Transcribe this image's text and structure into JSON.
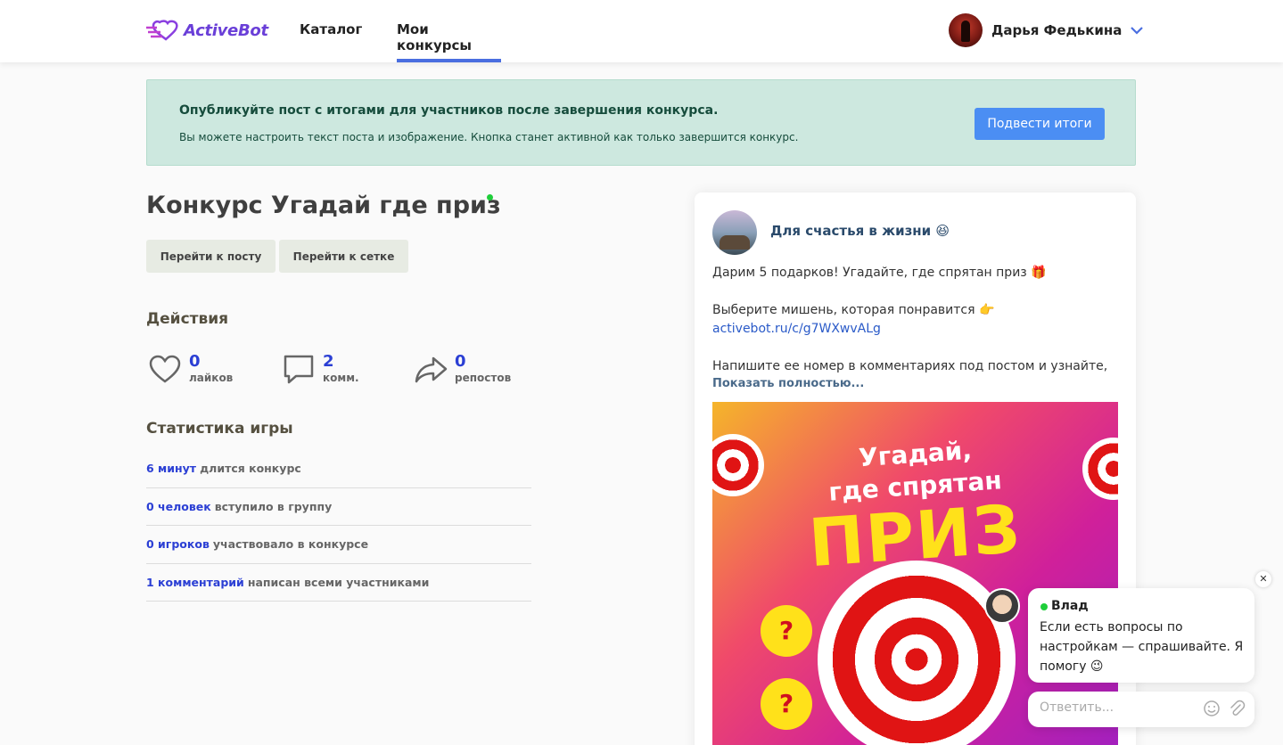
{
  "header": {
    "logo": "ActiveBot",
    "nav": {
      "catalog": "Каталог",
      "my_contests": "Мои конкурсы"
    },
    "user_name": "Дарья Федькина"
  },
  "banner": {
    "title": "Опубликуйте пост с итогами для участников после завершения конкурса.",
    "text": "Вы можете настроить текст поста и изображение. Кнопка станет активной как только завершится конкурс.",
    "button": "Подвести итоги"
  },
  "contest": {
    "title": "Конкурс Угадай где приз",
    "btn_post": "Перейти к посту",
    "btn_grid": "Перейти к сетке"
  },
  "actions": {
    "title": "Действия",
    "likes": {
      "value": "0",
      "label": "лайков"
    },
    "comments": {
      "value": "2",
      "label": "комм."
    },
    "reposts": {
      "value": "0",
      "label": "репостов"
    }
  },
  "stats": {
    "title": "Статистика игры",
    "rows": [
      {
        "value": "6 минут",
        "text": "длится конкурс"
      },
      {
        "value": "0 человек",
        "text": "вступило в группу"
      },
      {
        "value": "0 игроков",
        "text": "участвовало в конкурсе"
      },
      {
        "value": "1 комментарий",
        "text": "написан всеми участниками"
      }
    ]
  },
  "post": {
    "group_name": "Для счастья в жизни 😆",
    "line1": "Дарим 5 подарков! Угадайте, где спрятан приз 🎁",
    "line2": "Выберите мишень, которая понравится 👉",
    "link": "activebot.ru/c/g7WXwvALg",
    "line3": "Напишите ее номер в комментариях под постом и узнайте,",
    "show_more": "Показать полностью...",
    "image": {
      "text1": "Угадай,",
      "text2": "где спрятан",
      "text3": "ПРИЗ",
      "q1": "?",
      "q2": "?"
    }
  },
  "chat": {
    "name": "Влад",
    "message": "Если есть вопросы по настройкам — спрашивайте. Я помогу 😉",
    "placeholder": "Ответить...",
    "close": "✕"
  }
}
